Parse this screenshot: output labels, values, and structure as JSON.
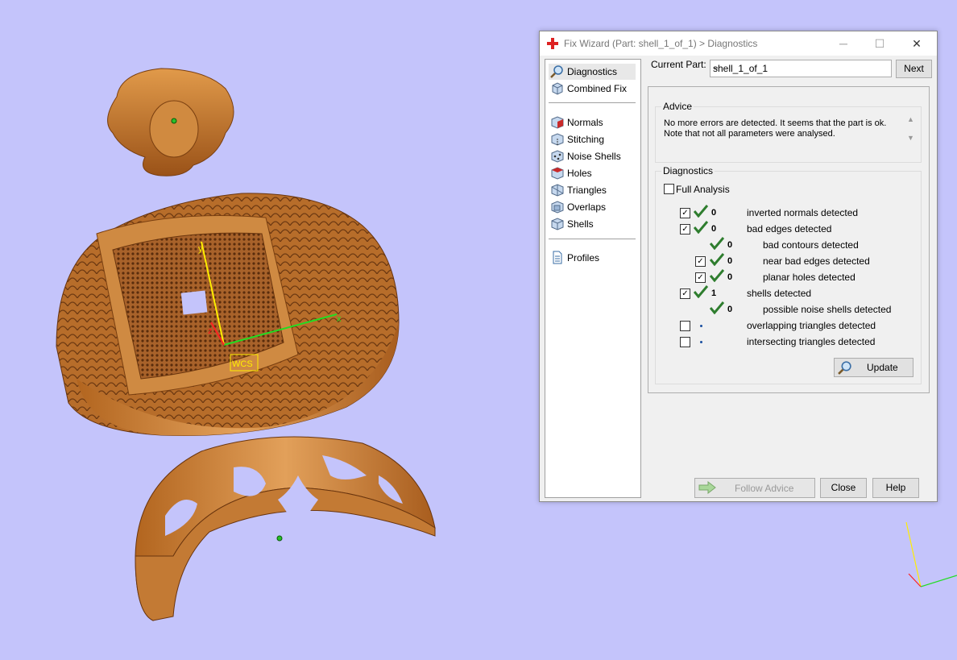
{
  "window": {
    "title": "Fix Wizard (Part: shell_1_of_1) > Diagnostics",
    "minimize": "─",
    "maximize": "☐",
    "close": "✕"
  },
  "nav": {
    "items": [
      {
        "label": "Diagnostics"
      },
      {
        "label": "Combined Fix"
      },
      {
        "label": "Normals"
      },
      {
        "label": "Stitching"
      },
      {
        "label": "Noise Shells"
      },
      {
        "label": "Holes"
      },
      {
        "label": "Triangles"
      },
      {
        "label": "Overlaps"
      },
      {
        "label": "Shells"
      },
      {
        "label": "Profiles"
      }
    ]
  },
  "current_part": {
    "label": "Current Part:",
    "value": "shell_1_of_1",
    "next_label": "Next"
  },
  "advice": {
    "title": "Advice",
    "text": "No more errors are detected. It seems that the part is ok. Note that not all parameters were analysed."
  },
  "diagnostics": {
    "title": "Diagnostics",
    "full_analysis": "Full Analysis",
    "rows": [
      {
        "count": "0",
        "label": "inverted normals detected"
      },
      {
        "count": "0",
        "label": "bad edges detected"
      },
      {
        "count": "0",
        "label": "bad contours detected"
      },
      {
        "count": "0",
        "label": "near bad edges detected"
      },
      {
        "count": "0",
        "label": "planar holes detected"
      },
      {
        "count": "1",
        "label": "shells detected"
      },
      {
        "count": "0",
        "label": "possible noise shells detected"
      },
      {
        "count": "",
        "label": "overlapping triangles detected"
      },
      {
        "count": "",
        "label": "intersecting triangles detected"
      }
    ],
    "update_label": "Update"
  },
  "footer": {
    "follow_advice": "Follow Advice",
    "close": "Close",
    "help": "Help"
  },
  "viewport": {
    "wcs_label": "WCS",
    "axis_x": "x",
    "axis_y": "y",
    "axis_z": "z"
  },
  "colors": {
    "background": "#c4c4fb",
    "gold": "#c97a2c",
    "check_green": "#2e7d2e",
    "accent_red": "#d22"
  }
}
